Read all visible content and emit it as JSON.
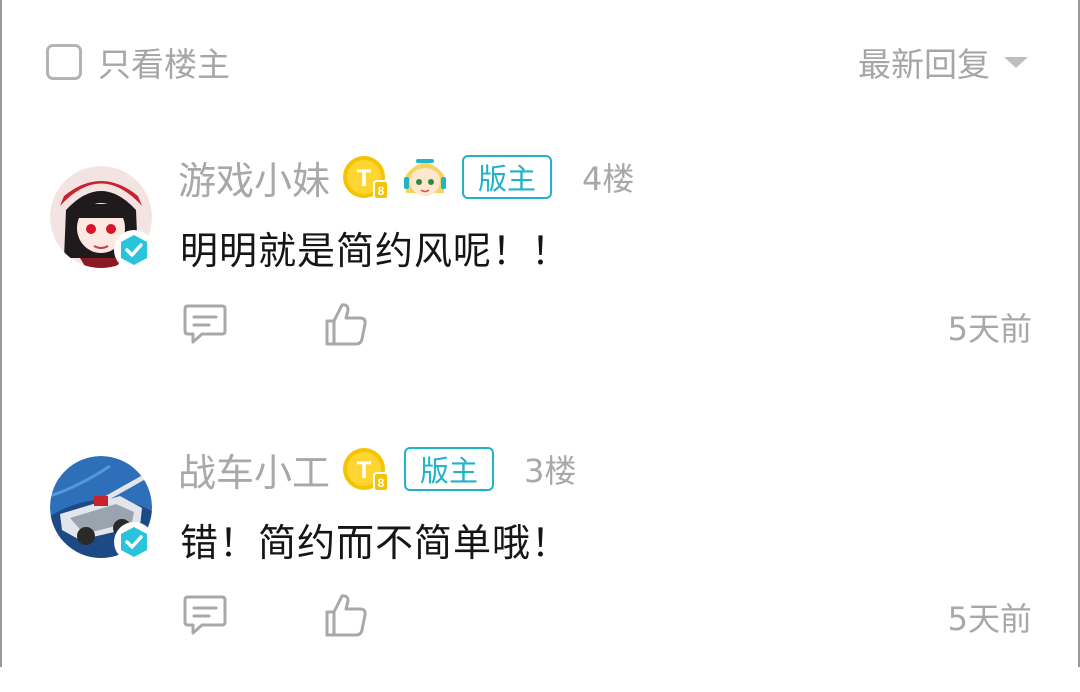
{
  "filter": {
    "op_only_label": "只看楼主",
    "sort_label": "最新回复"
  },
  "replies": [
    {
      "username": "游戏小妹",
      "badge_t": "T",
      "badge_t_sub": "8",
      "mod_label": "版主",
      "floor": "4楼",
      "content": "明明就是简约风呢！！",
      "time": "5天前"
    },
    {
      "username": "战车小工",
      "badge_t": "T",
      "badge_t_sub": "8",
      "mod_label": "版主",
      "floor": "3楼",
      "content": "错！简约而不简单哦！",
      "time": "5天前"
    }
  ],
  "colors": {
    "accent": "#21b3c8",
    "muted_text": "#a8a8a8",
    "body_text": "#151515",
    "badge_gold": "#f5c400"
  },
  "icons": [
    "checkbox-icon",
    "caret-down-icon",
    "verified-icon",
    "comment-icon",
    "like-icon",
    "level-t-badge-icon"
  ]
}
